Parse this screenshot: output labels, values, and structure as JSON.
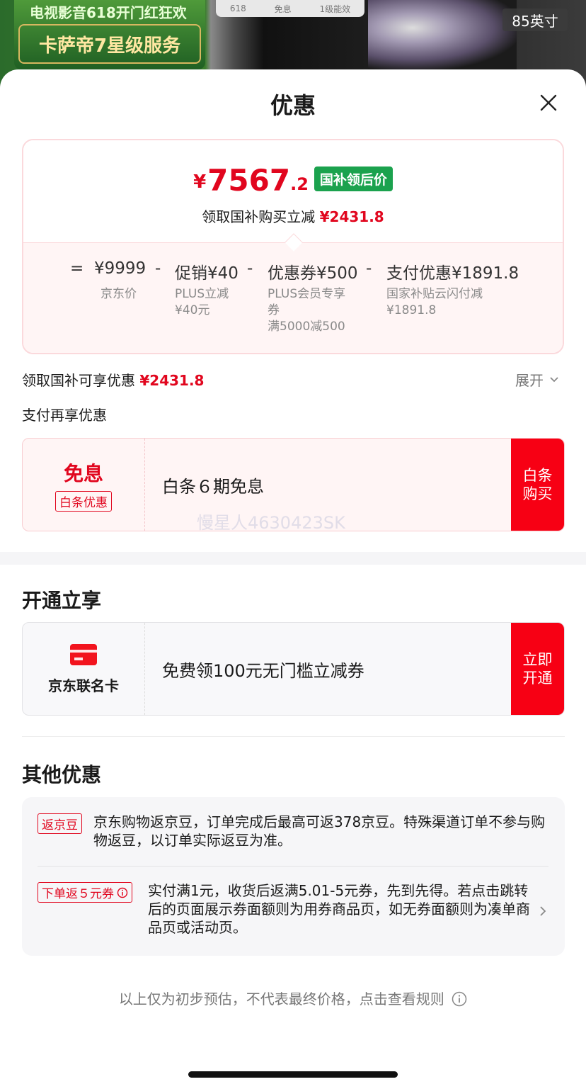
{
  "background": {
    "promo_line1": "电视影音618开门红狂欢",
    "promo_line2": "卡萨帝7星级服务",
    "badges": [
      "618",
      "免息",
      "1级能效"
    ],
    "size_label": "85英寸"
  },
  "sheet": {
    "title": "优惠"
  },
  "price_card": {
    "currency": "¥",
    "price_int": "7567",
    "price_dec": ".2",
    "price_tag": "国补领后价",
    "subtitle_prefix": "领取国补购买立减",
    "subtitle_amount": "¥2431.8",
    "formula": [
      {
        "sign": "=",
        "value": "¥9999",
        "note": "京东价"
      },
      {
        "sign": "-",
        "value": "促销¥40",
        "note": "PLUS立减\n¥40元"
      },
      {
        "sign": "-",
        "value": "优惠券¥500",
        "note": "PLUS会员专享\n券\n满5000减500"
      },
      {
        "sign": "-",
        "value": "支付优惠¥1891.8",
        "note": "国家补贴云闪付减\n¥1891.8"
      }
    ]
  },
  "subsidy_row": {
    "label": "领取国补可享优惠",
    "amount": "¥2431.8",
    "expand": "展开"
  },
  "pay_section": {
    "title": "支付再享优惠"
  },
  "baitiao_card": {
    "main": "免息",
    "tag": "白条优惠",
    "desc": "白条６期免息",
    "button": "白条\n购买",
    "watermark": "慢星人4630423SK"
  },
  "open_section": {
    "title": "开通立享"
  },
  "card_offer": {
    "name": "京东联名卡",
    "desc": "免费领100元无门槛立减券",
    "button": "立即\n开通"
  },
  "others_section": {
    "title": "其他优惠",
    "items": [
      {
        "tag": "返京豆",
        "text": "京东购物返京豆，订单完成后最高可返378京豆。特殊渠道订单不参与购物返豆，以订单实际返豆为准。"
      },
      {
        "tag": "下单返５元券",
        "text": "实付满1元，收货后返满5.01-5元券，先到先得。若点击跳转后的页面展示券面额则为用券商品页，如无券面额则为凑单商品页或活动页。"
      }
    ]
  },
  "footer": {
    "text": "以上仅为初步预估，不代表最终价格，点击查看规则"
  },
  "colors": {
    "accent": "#e1061e",
    "button": "#f70014",
    "green_tag": "#1ba24e",
    "card_border": "#fbd9dc"
  }
}
